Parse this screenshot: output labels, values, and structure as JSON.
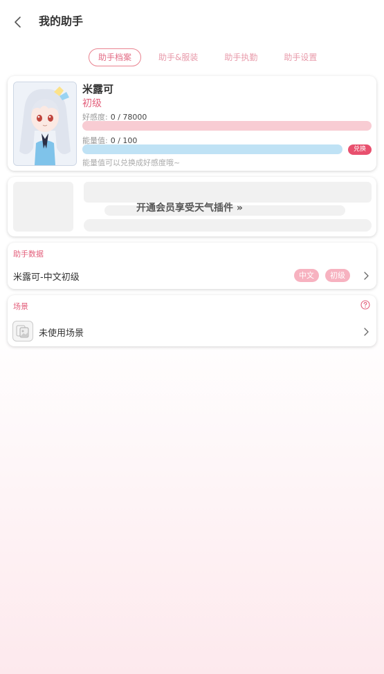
{
  "header": {
    "back_icon": "chevron-left-icon",
    "title": "我的助手"
  },
  "tabs": [
    {
      "label": "助手档案",
      "active": true
    },
    {
      "label": "助手&服装",
      "active": false
    },
    {
      "label": "助手执勤",
      "active": false
    },
    {
      "label": "助手设置",
      "active": false
    }
  ],
  "profile": {
    "name": "米露可",
    "level": "初级",
    "favorability_label": "好感度:",
    "favorability_value": "0 / 78000",
    "energy_label": "能量值:",
    "energy_value": "0 / 100",
    "favorability_progress": 0,
    "energy_progress": 0,
    "redeem_label": "兑换",
    "energy_hint": "能量值可以兑换成好感度哦~"
  },
  "weather_promo": {
    "text": "开通会员享受天气插件 »"
  },
  "assistant_data": {
    "section_title": "助手数据",
    "item_name": "米露可-中文初级",
    "tags": [
      "中文",
      "初级"
    ]
  },
  "scene": {
    "section_title": "场景",
    "help_icon": "question-circle-icon",
    "item_label": "未使用场景"
  },
  "colors": {
    "accent": "#e3607c",
    "favorability_bar": "#f8ccd3",
    "energy_bar": "#bfe2f5",
    "redeem_button": "#e8506e",
    "tag": "#f7b2c0"
  }
}
